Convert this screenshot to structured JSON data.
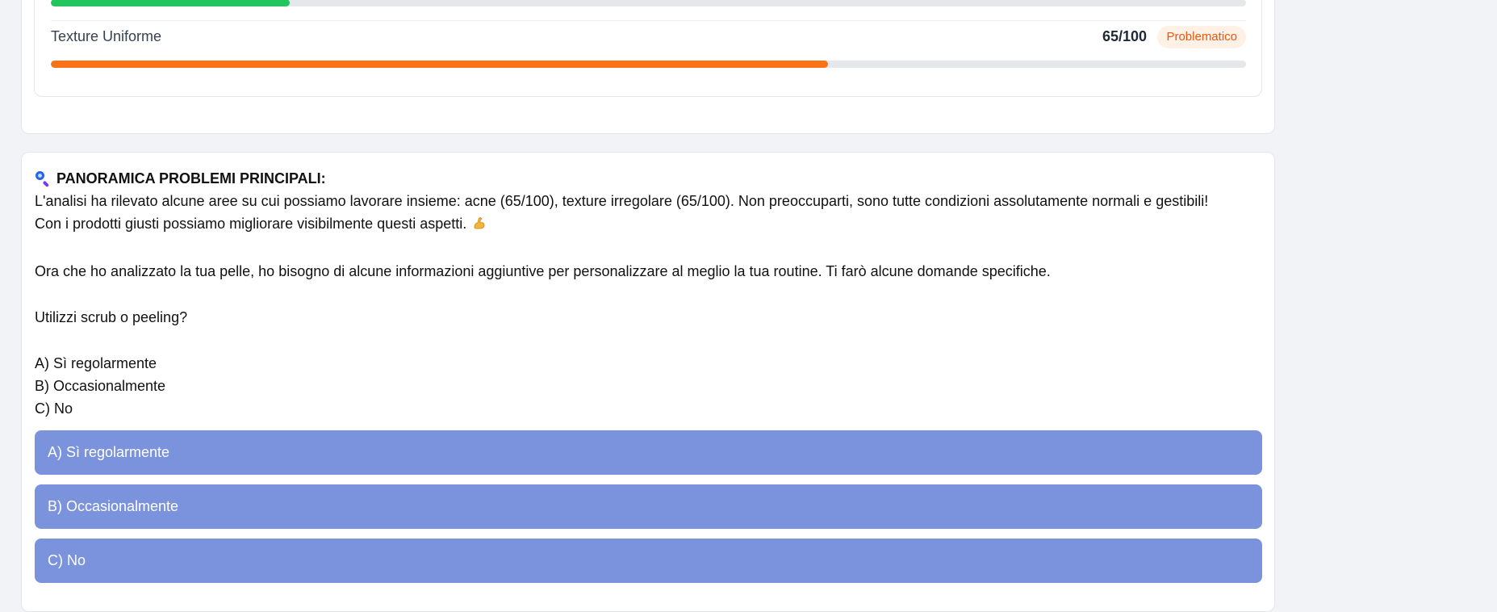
{
  "metrics": {
    "previous_bar": {
      "fraction": 0.2,
      "color": "#22c55e"
    },
    "texture": {
      "label": "Texture Uniforme",
      "score": "65/100",
      "fraction": 0.65,
      "badge": "Problematico",
      "color": "#f97316"
    }
  },
  "message": {
    "heading_icon": "magnifying-glass-icon",
    "heading": "PANORAMICA PROBLEMI PRINCIPALI:",
    "line1": "L'analisi ha rilevato alcune aree su cui possiamo lavorare insieme: acne (65/100), texture irregolare (65/100). Non preoccuparti, sono tutte condizioni assolutamente normali e gestibili!",
    "line2": "Con i prodotti giusti possiamo migliorare visibilmente questi aspetti.",
    "line2_icon": "flexed-biceps-icon",
    "intro": "Ora che ho analizzato la tua pelle, ho bisogno di alcune informazioni aggiuntive per personalizzare al meglio la tua routine. Ti farò alcune domande specifiche.",
    "question": "Utilizzi scrub o peeling?",
    "options": [
      "A) Sì regolarmente",
      "B) Occasionalmente",
      "C) No"
    ]
  },
  "answer_buttons": {
    "a": "A) Sì regolarmente",
    "b": "B) Occasionalmente",
    "c": "C) No",
    "color": "#7b93dc"
  }
}
